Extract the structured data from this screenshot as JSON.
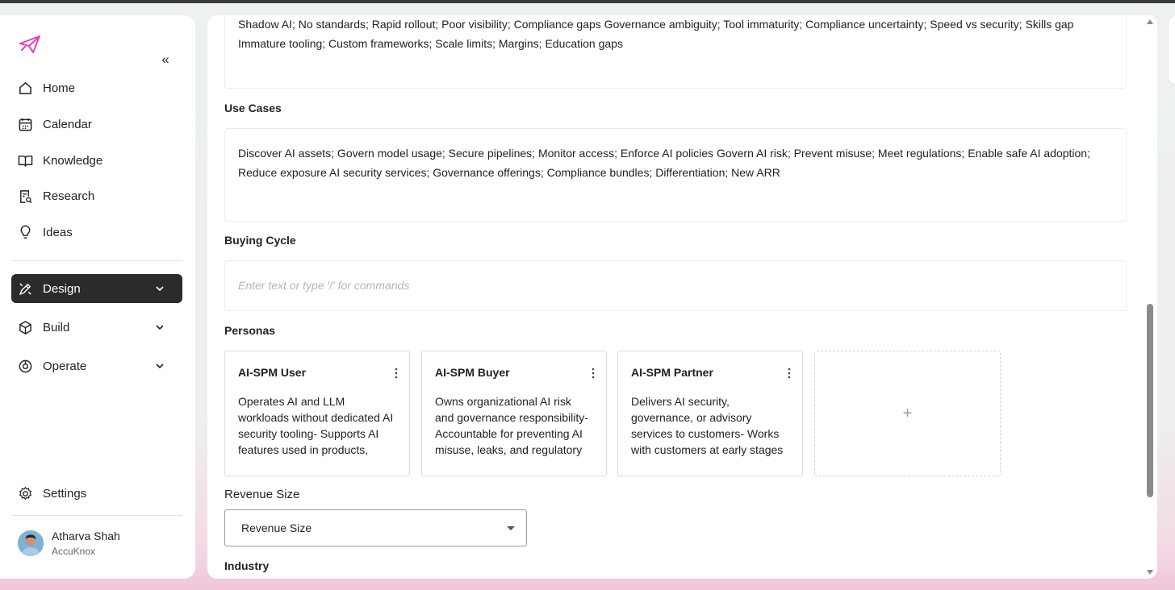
{
  "sidebar": {
    "nav": [
      {
        "label": "Home",
        "icon": "home-icon"
      },
      {
        "label": "Calendar",
        "icon": "calendar-icon"
      },
      {
        "label": "Knowledge",
        "icon": "book-icon"
      },
      {
        "label": "Research",
        "icon": "research-icon"
      },
      {
        "label": "Ideas",
        "icon": "lightbulb-icon"
      }
    ],
    "groups": [
      {
        "label": "Design",
        "icon": "pen-icon",
        "active": true
      },
      {
        "label": "Build",
        "icon": "cube-icon"
      },
      {
        "label": "Operate",
        "icon": "operate-icon"
      }
    ],
    "settings_label": "Settings",
    "user": {
      "name": "Atharva Shah",
      "org": "AccuKnox"
    },
    "accent_color": "#e040b8"
  },
  "main": {
    "challenges_text_line1": "Shadow AI; No standards; Rapid rollout; Poor visibility; Compliance gaps Governance ambiguity; Tool immaturity; Compliance uncertainty; Speed vs security; Skills gap",
    "challenges_text_line2": "Immature tooling; Custom frameworks; Scale limits; Margins; Education gaps",
    "use_cases_label": "Use Cases",
    "use_cases_line1": "Discover AI assets; Govern model usage; Secure pipelines; Monitor access; Enforce AI policies Govern AI risk; Prevent misuse; Meet regulations; Enable safe AI adoption;",
    "use_cases_line2": "Reduce exposure AI security services; Governance offerings; Compliance bundles; Differentiation; New ARR",
    "buying_cycle_label": "Buying Cycle",
    "buying_cycle_placeholder": "Enter text or type '/' for commands",
    "personas_label": "Personas",
    "personas": [
      {
        "title": "AI-SPM User",
        "desc": "Operates AI and LLM workloads without dedicated AI security tooling- Supports AI features used in products, integrating the tools"
      },
      {
        "title": "AI-SPM Buyer",
        "desc": "Owns organizational AI risk and governance responsibility- Accountable for preventing AI misuse, leaks, and regulatory"
      },
      {
        "title": "AI-SPM Partner",
        "desc": "Delivers AI security, governance, or advisory services to customers- Works with customers at early stages of AI adoption, advising"
      }
    ],
    "add_persona_symbol": "+",
    "revenue_size_label": "Revenue Size",
    "revenue_size_value": "Revenue Size",
    "industry_label": "Industry"
  }
}
